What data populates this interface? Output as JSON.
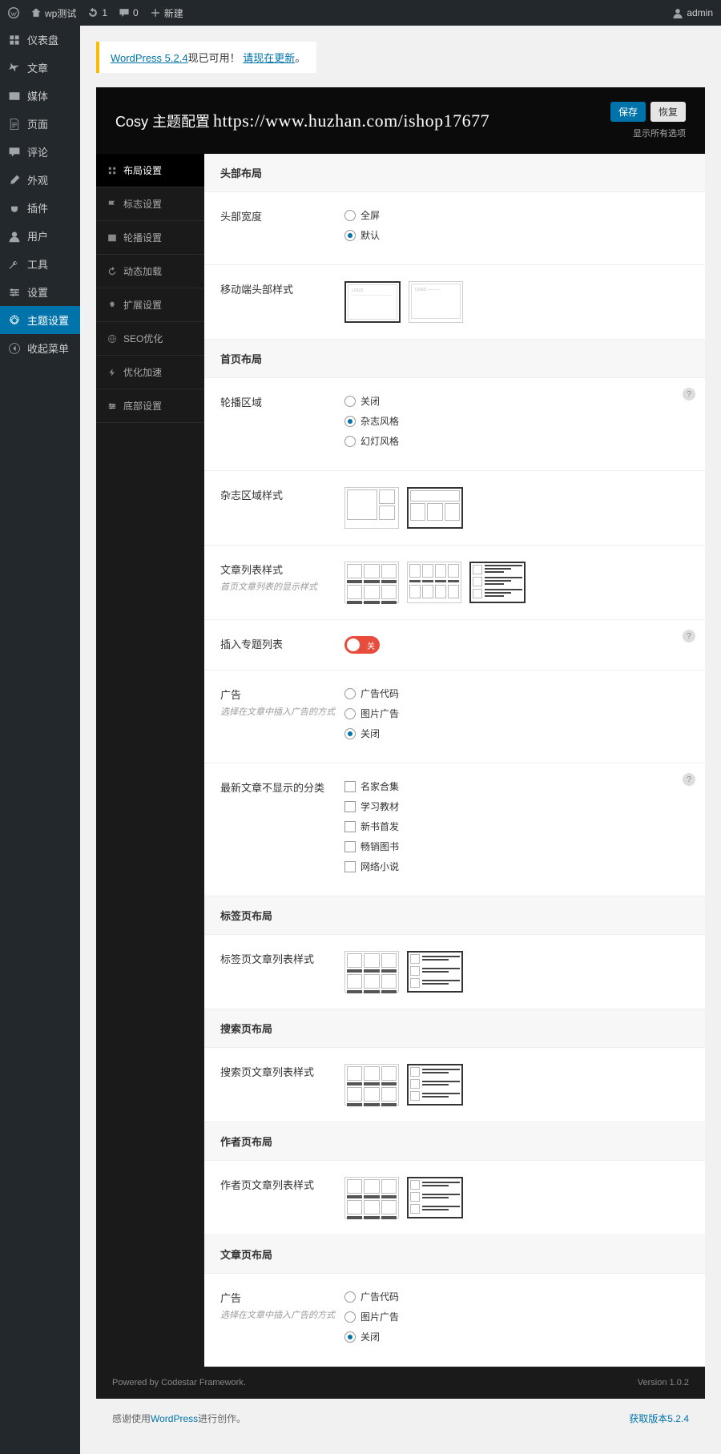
{
  "adminbar": {
    "site": "wp测试",
    "updates": "1",
    "comments": "0",
    "new": "新建",
    "user": "admin"
  },
  "leftnav": [
    {
      "label": "仪表盘",
      "icon": "dashboard"
    },
    {
      "label": "文章",
      "icon": "pin"
    },
    {
      "label": "媒体",
      "icon": "media"
    },
    {
      "label": "页面",
      "icon": "pages"
    },
    {
      "label": "评论",
      "icon": "comment"
    },
    {
      "label": "外观",
      "icon": "brush"
    },
    {
      "label": "插件",
      "icon": "plug"
    },
    {
      "label": "用户",
      "icon": "user"
    },
    {
      "label": "工具",
      "icon": "wrench"
    },
    {
      "label": "设置",
      "icon": "slider"
    },
    {
      "label": "主题设置",
      "icon": "gear",
      "current": true
    },
    {
      "label": "收起菜单",
      "icon": "collapse"
    }
  ],
  "notice": {
    "version": "WordPress 5.2.4",
    "text": "现已可用！",
    "link": "请现在更新"
  },
  "header": {
    "title": "Cosy 主题配置",
    "watermark": "https://www.huzhan.com/ishop17677",
    "save": "保存",
    "reset": "恢复",
    "expand": "显示所有选项"
  },
  "nav": [
    {
      "label": "布局设置",
      "active": true
    },
    {
      "label": "标志设置"
    },
    {
      "label": "轮播设置"
    },
    {
      "label": "动态加载"
    },
    {
      "label": "扩展设置"
    },
    {
      "label": "SEO优化"
    },
    {
      "label": "优化加速"
    },
    {
      "label": "底部设置"
    }
  ],
  "sections": {
    "header_layout": {
      "title": "头部布局"
    },
    "header_width": {
      "label": "头部宽度",
      "options": [
        "全屏",
        "默认"
      ],
      "checked": 1
    },
    "mobile_header": {
      "label": "移动端头部样式"
    },
    "home_layout": {
      "title": "首页布局"
    },
    "carousel_area": {
      "label": "轮播区域",
      "options": [
        "关闭",
        "杂志风格",
        "幻灯风格"
      ],
      "checked": 1
    },
    "magazine_style": {
      "label": "杂志区域样式"
    },
    "post_list_style": {
      "label": "文章列表样式",
      "desc": "首页文章列表的显示样式"
    },
    "insert_special": {
      "label": "插入专题列表",
      "toggle_text": "关"
    },
    "ad1": {
      "label": "广告",
      "desc": "选择在文章中插入广告的方式",
      "options": [
        "广告代码",
        "图片广告",
        "关闭"
      ],
      "checked": 2
    },
    "exclude_cats": {
      "label": "最新文章不显示的分类",
      "options": [
        "名家合集",
        "学习教材",
        "新书首发",
        "畅销图书",
        "网络小说"
      ]
    },
    "tag_layout": {
      "title": "标签页布局"
    },
    "tag_list_style": {
      "label": "标签页文章列表样式"
    },
    "search_layout": {
      "title": "搜索页布局"
    },
    "search_list_style": {
      "label": "搜索页文章列表样式"
    },
    "author_layout": {
      "title": "作者页布局"
    },
    "author_list_style": {
      "label": "作者页文章列表样式"
    },
    "article_layout": {
      "title": "文章页布局"
    },
    "ad2": {
      "label": "广告",
      "desc": "选择在文章中插入广告的方式",
      "options": [
        "广告代码",
        "图片广告",
        "关闭"
      ],
      "checked": 2
    }
  },
  "footer": {
    "powered": "Powered by Codestar Framework.",
    "version": "Version 1.0.2",
    "thanks_prefix": "感谢使用",
    "thanks_link": "WordPress",
    "thanks_suffix": "进行创作。",
    "get_version": "获取版本5.2.4"
  }
}
